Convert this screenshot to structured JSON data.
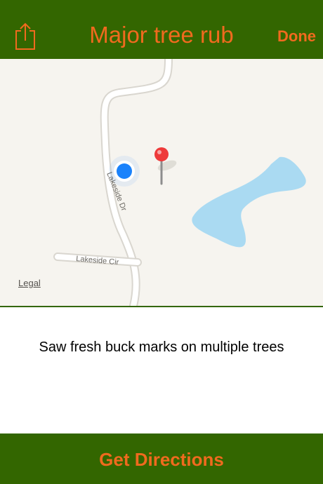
{
  "header": {
    "title": "Major tree rub",
    "done_label": "Done",
    "share_icon": "share-icon"
  },
  "map": {
    "roads": [
      "Lakeside Dr",
      "Lakeside Cir"
    ],
    "legal_label": "Legal",
    "pin_icon": "map-pin-icon",
    "location_icon": "current-location-icon"
  },
  "notes": {
    "text": "Saw fresh buck marks on multiple trees"
  },
  "footer": {
    "directions_label": "Get Directions"
  },
  "colors": {
    "bar_background": "#336600",
    "accent": "#f06a1e",
    "map_background": "#f6f4ef",
    "water": "#aadaf2",
    "location_dot": "#1a82fb",
    "pin": "#ee3a3a"
  }
}
